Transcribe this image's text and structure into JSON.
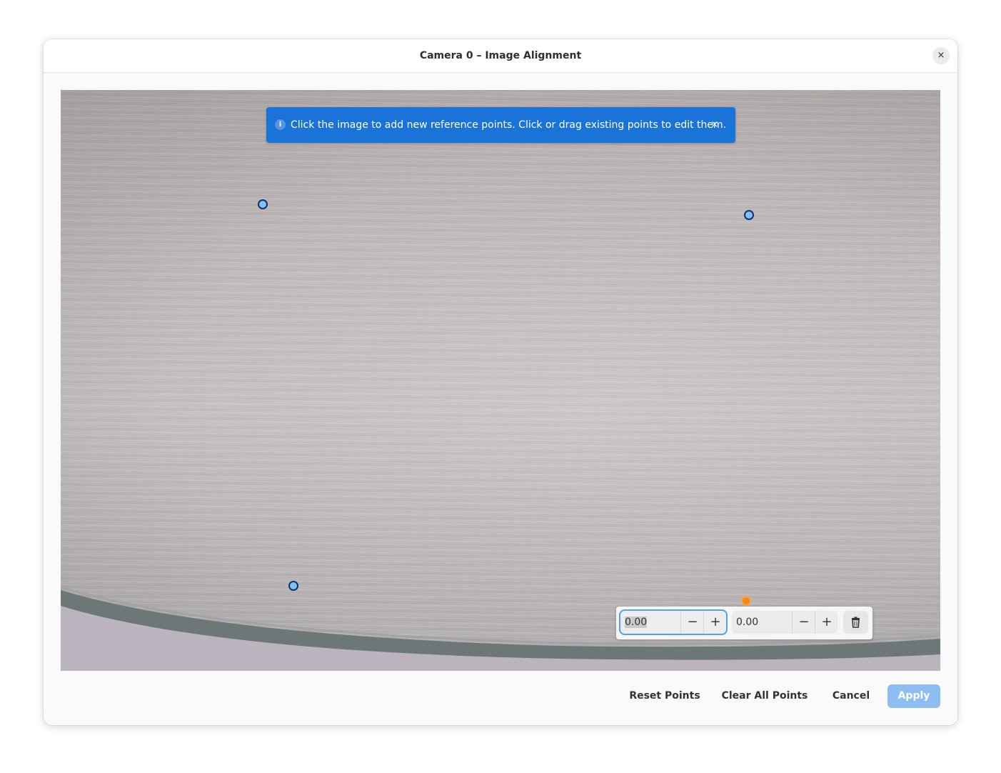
{
  "window": {
    "title": "Camera 0 – Image Alignment",
    "close_label": "×"
  },
  "banner": {
    "info_glyph": "i",
    "message": "Click the image to add new reference points. Click or drag existing points to edit them.",
    "close_label": "×"
  },
  "point_editor": {
    "x_value": "0.00",
    "y_value": "0.00",
    "decrement_label": "−",
    "increment_label": "+",
    "delete_icon": "trash-icon"
  },
  "footer": {
    "reset_label": "Reset Points",
    "clear_label": "Clear All Points",
    "cancel_label": "Cancel",
    "apply_label": "Apply"
  },
  "colors": {
    "accent": "#1a73d9",
    "point_fill": "#7ec3f4",
    "point_stroke": "#14316d",
    "selected_point": "#f28b14",
    "apply_disabled": "#8dbdf1"
  }
}
